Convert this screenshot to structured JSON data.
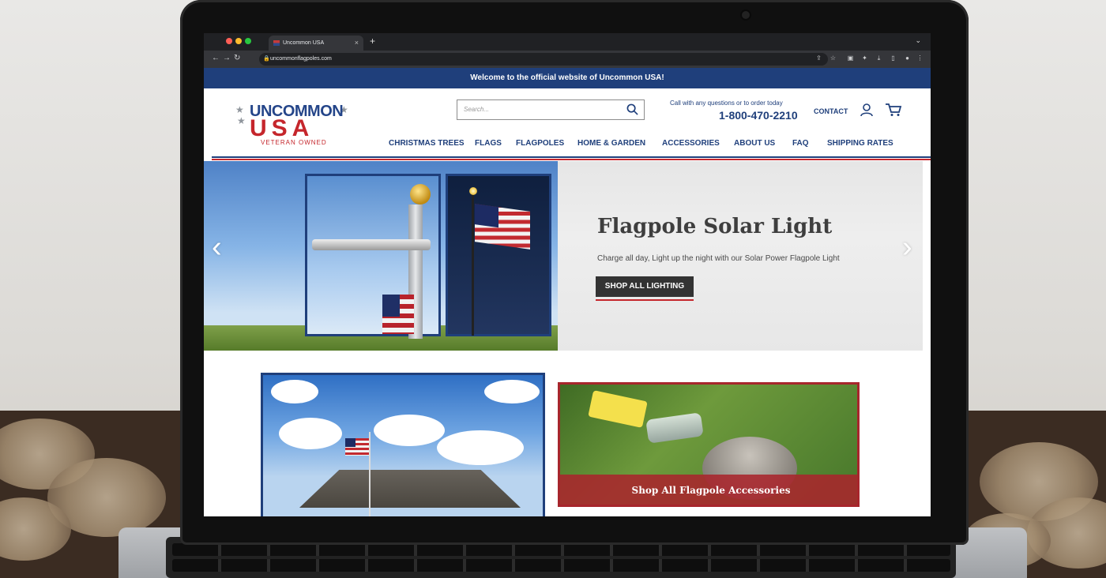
{
  "browser": {
    "tab_title": "Uncommon USA",
    "tab_close": "×",
    "new_tab": "+",
    "url": "uncommonflagpoles.com"
  },
  "site": {
    "banner_text": "Welcome to the official website of Uncommon USA!",
    "logo": {
      "line1": "UNCOMMON",
      "line2": "USA",
      "line3": "VETERAN OWNED"
    },
    "search_placeholder": "Search...",
    "call_text": "Call with any questions or to order today",
    "phone": "1-800-470-2210",
    "contact_label": "CONTACT",
    "nav": [
      {
        "label": "CHRISTMAS TREES"
      },
      {
        "label": "FLAGS"
      },
      {
        "label": "FLAGPOLES"
      },
      {
        "label": "HOME & GARDEN"
      },
      {
        "label": "ACCESSORIES"
      },
      {
        "label": "ABOUT US"
      },
      {
        "label": "FAQ"
      },
      {
        "label": "SHIPPING RATES"
      }
    ],
    "hero": {
      "title": "Flagpole Solar Light",
      "subtitle": "Charge all day, Light up the night with our Solar Power Flagpole Light",
      "button_label": "SHOP ALL LIGHTING",
      "prev_arrow": "‹",
      "next_arrow": "›"
    },
    "promo_card_2_label": "Shop All Flagpole Accessories"
  },
  "colors": {
    "brand_blue": "#1f3f7b",
    "brand_red": "#c5262c",
    "hero_button": "#333333"
  },
  "icons": [
    "search-icon",
    "user-icon",
    "cart-icon",
    "lock-icon",
    "back-icon",
    "forward-icon",
    "reload-icon",
    "star-icon",
    "extensions-icon",
    "download-icon",
    "menu-icon"
  ]
}
